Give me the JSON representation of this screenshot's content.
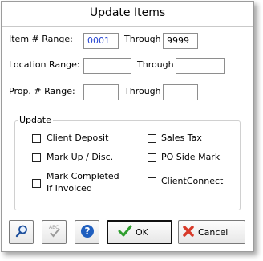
{
  "dialog": {
    "title": "Update Items"
  },
  "ranges": {
    "item": {
      "label": "Item # Range:",
      "from": "0001",
      "through_label": "Through",
      "to": "9999"
    },
    "location": {
      "label": "Location Range:",
      "from": "",
      "through_label": "Through",
      "to": ""
    },
    "prop": {
      "label": "Prop. # Range:",
      "from": "",
      "through_label": "Through",
      "to": ""
    }
  },
  "update": {
    "label": "Update",
    "options": {
      "client_deposit": {
        "label": "Client Deposit",
        "checked": false
      },
      "sales_tax": {
        "label": "Sales Tax",
        "checked": false
      },
      "mark_up_disc": {
        "label": "Mark Up / Disc.",
        "checked": false
      },
      "po_side_mark": {
        "label": "PO Side Mark",
        "checked": false
      },
      "mark_completed": {
        "label_line1": "Mark Completed",
        "label_line2": "If Invoiced",
        "checked": false
      },
      "client_connect": {
        "label": "ClientConnect",
        "checked": false
      }
    }
  },
  "buttons": {
    "search_icon": "magnifier-icon",
    "spell_icon": "spell-check-icon",
    "help_icon": "help-icon",
    "spell_badge": "ABC",
    "help_glyph": "?",
    "ok": "OK",
    "cancel": "Cancel"
  },
  "colors": {
    "value_text": "#1f3fd0",
    "ok_check": "#2e9e2e",
    "cancel_x": "#d83a2a",
    "help_circle": "#1f5fbf"
  }
}
